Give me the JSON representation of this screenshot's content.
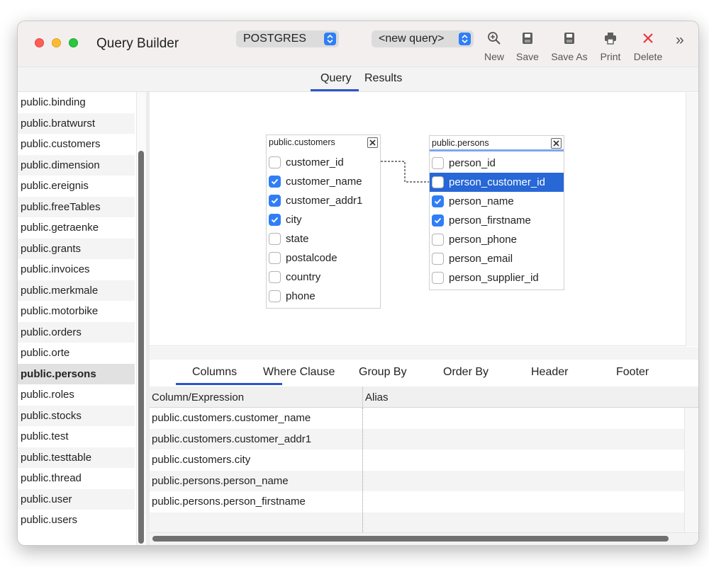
{
  "window": {
    "title": "Query Builder"
  },
  "toolbar": {
    "db_select": "POSTGRES",
    "query_select": "<new query>",
    "buttons": [
      {
        "label": "New",
        "icon": "zoom-in-icon"
      },
      {
        "label": "Save",
        "icon": "save-icon"
      },
      {
        "label": "Save As",
        "icon": "save-as-icon"
      },
      {
        "label": "Print",
        "icon": "print-icon"
      },
      {
        "label": "Delete",
        "icon": "delete-x-icon"
      }
    ],
    "overflow": "»"
  },
  "tabs": [
    {
      "label": "Query"
    },
    {
      "label": "Results"
    }
  ],
  "sidebar": {
    "items": [
      "public.binding",
      "public.bratwurst",
      "public.customers",
      "public.dimension",
      "public.ereignis",
      "public.freeTables",
      "public.getraenke",
      "public.grants",
      "public.invoices",
      "public.merkmale",
      "public.motorbike",
      "public.orders",
      "public.orte",
      "public.persons",
      "public.roles",
      "public.stocks",
      "public.test",
      "public.testtable",
      "public.thread",
      "public.user",
      "public.users"
    ],
    "selected": "public.persons"
  },
  "tables": [
    {
      "name": "public.customers",
      "fields": [
        {
          "name": "customer_id",
          "checked": false
        },
        {
          "name": "customer_name",
          "checked": true
        },
        {
          "name": "customer_addr1",
          "checked": true
        },
        {
          "name": "city",
          "checked": true
        },
        {
          "name": "state",
          "checked": false
        },
        {
          "name": "postalcode",
          "checked": false
        },
        {
          "name": "country",
          "checked": false
        },
        {
          "name": "phone",
          "checked": false
        }
      ]
    },
    {
      "name": "public.persons",
      "fields": [
        {
          "name": "person_id",
          "checked": false
        },
        {
          "name": "person_customer_id",
          "checked": false,
          "selected": true
        },
        {
          "name": "person_name",
          "checked": true
        },
        {
          "name": "person_firstname",
          "checked": true
        },
        {
          "name": "person_phone",
          "checked": false
        },
        {
          "name": "person_email",
          "checked": false
        },
        {
          "name": "person_supplier_id",
          "checked": false
        }
      ]
    }
  ],
  "bottom_tabs": [
    {
      "label": "Columns"
    },
    {
      "label": "Where Clause"
    },
    {
      "label": "Group By"
    },
    {
      "label": "Order By"
    },
    {
      "label": "Header"
    },
    {
      "label": "Footer"
    }
  ],
  "grid": {
    "headers": [
      "Column/Expression",
      "Alias"
    ],
    "rows": [
      {
        "column": "public.customers.customer_name",
        "alias": ""
      },
      {
        "column": "public.customers.customer_addr1",
        "alias": ""
      },
      {
        "column": "public.customers.city",
        "alias": ""
      },
      {
        "column": "public.persons.person_name",
        "alias": ""
      },
      {
        "column": "public.persons.person_firstname",
        "alias": ""
      },
      {
        "column": "",
        "alias": ""
      }
    ]
  },
  "colors": {
    "accent": "#2f7ef6",
    "selection": "#2767d6",
    "delete": "#e5383b"
  }
}
